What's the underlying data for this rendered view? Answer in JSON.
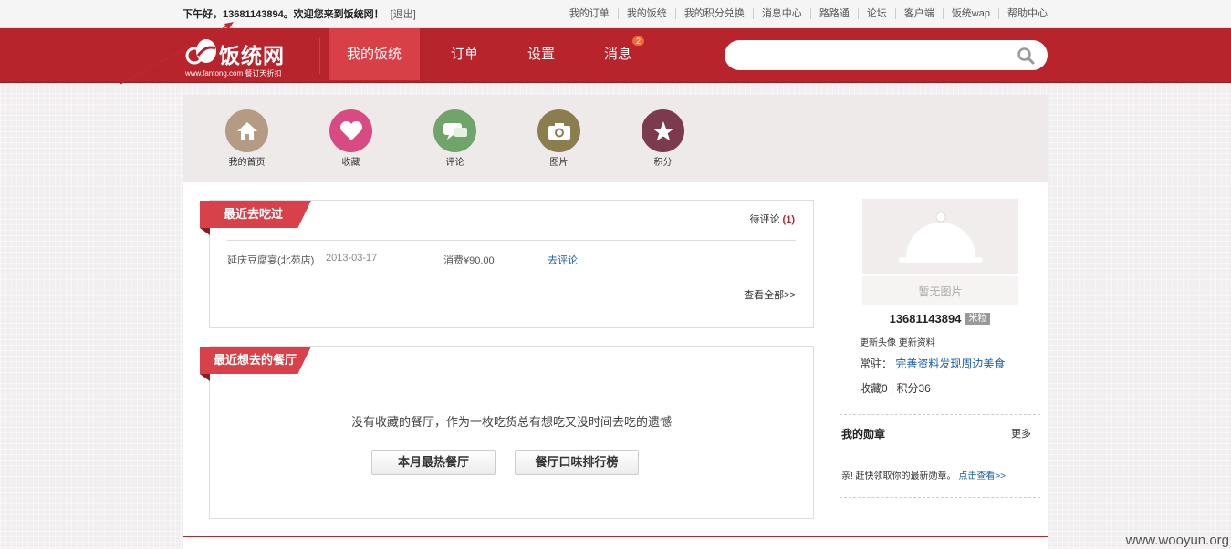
{
  "topbar": {
    "greeting": "下午好，13681143894。欢迎您来到饭统网！",
    "logout": "[退出]",
    "links": [
      "我的订单",
      "我的饭统",
      "我的积分兑换",
      "消息中心",
      "路路通",
      "论坛",
      "客户端",
      "饭统wap",
      "帮助中心"
    ]
  },
  "header": {
    "logo_name": "饭统网",
    "logo_sub": "www.fantong.com 餐订天折扣",
    "nav": [
      {
        "label": "我的饭统",
        "active": true
      },
      {
        "label": "订单"
      },
      {
        "label": "设置"
      },
      {
        "label": "消息",
        "badge": "2"
      }
    ],
    "search_placeholder": ""
  },
  "iconbar": [
    {
      "label": "我的首页",
      "color": "#b59a84",
      "icon": "home-icon"
    },
    {
      "label": "收藏",
      "color": "#d84a82",
      "icon": "heart-icon"
    },
    {
      "label": "评论",
      "color": "#6fa46a",
      "icon": "comment-icon"
    },
    {
      "label": "图片",
      "color": "#8c7d4f",
      "icon": "camera-icon"
    },
    {
      "label": "积分",
      "color": "#7c3a4e",
      "icon": "star-icon"
    }
  ],
  "recent": {
    "title": "最近去吃过",
    "pending_label": "待评论",
    "pending_count": "(1)",
    "row": {
      "restaurant": "延庆豆腐宴(北苑店)",
      "date": "2013-03-17",
      "spend": "消费¥90.00",
      "action": "去评论"
    },
    "view_all": "查看全部>>"
  },
  "wish": {
    "title": "最近想去的餐厅",
    "empty_msg": "没有收藏的餐厅，作为一枚吃货总有想吃又没时间去吃的遗憾",
    "btn_hot": "本月最热餐厅",
    "btn_rank": "餐厅口味排行榜"
  },
  "sidebar": {
    "no_image": "暂无图片",
    "username": "13681143894",
    "mili": "米粒",
    "edit_avatar": "更新头像",
    "edit_info": "更新资料",
    "resident_label": "常驻：",
    "resident_link": "完善资料发现周边美食",
    "stats": "收藏0 | 积分36",
    "medal_title": "我的勋章",
    "medal_more": "更多",
    "medal_msg": "亲! 赶快领取你的最新勋章。",
    "medal_link": "点击查看>>"
  },
  "watermark": "www.wooyun.org",
  "colors": {
    "brand_red": "#b8242b",
    "ribbon_red": "#d8404a",
    "link_blue": "#1d5fa7"
  }
}
